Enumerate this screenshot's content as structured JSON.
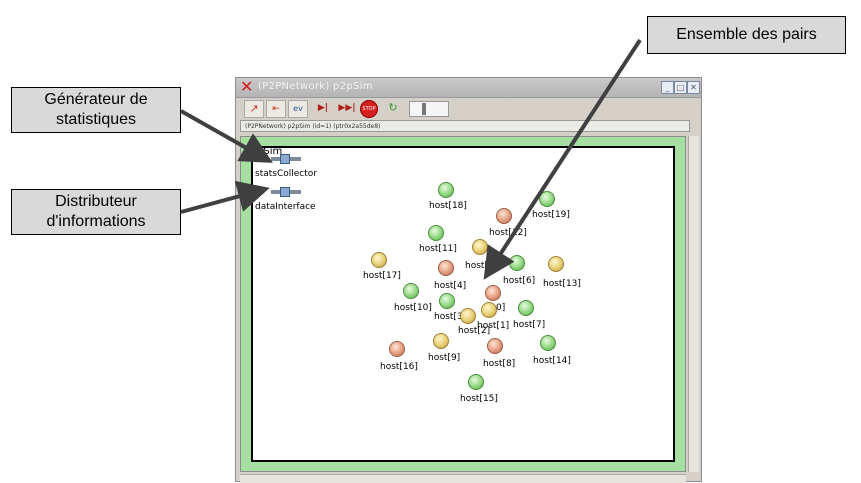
{
  "callouts": {
    "generator": "Générateur de\nstatistiques",
    "distributor": "Distributeur\nd'informations",
    "pairs": "Ensemble des pairs"
  },
  "window": {
    "title": "(P2PNetwork) p2pSim",
    "status": "(P2PNetwork) p2pSim (id=1) (ptr0x2a55de8)",
    "network_name": "P2Sim",
    "controls": [
      "minimize",
      "maximize",
      "close"
    ]
  },
  "toolbar": {
    "buttons": [
      {
        "icon": "step-back-icon",
        "glyph": "↗"
      },
      {
        "icon": "network-icon",
        "glyph": "⇤"
      },
      {
        "icon": "event-icon",
        "glyph": "ev"
      },
      {
        "icon": "run-icon",
        "glyph": "▶|"
      },
      {
        "icon": "fast-run-icon",
        "glyph": "▶▶|"
      },
      {
        "icon": "stop-icon",
        "glyph": "STOP"
      },
      {
        "icon": "refresh-icon",
        "glyph": "↻"
      }
    ]
  },
  "modules": [
    {
      "name": "statsCollector"
    },
    {
      "name": "dataInterface"
    }
  ],
  "hosts": [
    {
      "label": "host[18]",
      "color": "green"
    },
    {
      "label": "host[19]",
      "color": "green"
    },
    {
      "label": "host[12]",
      "color": "orange"
    },
    {
      "label": "host[11]",
      "color": "green"
    },
    {
      "label": "host[5]",
      "color": "yellow"
    },
    {
      "label": "host[17]",
      "color": "yellow"
    },
    {
      "label": "host[4]",
      "color": "orange"
    },
    {
      "label": "host[6]",
      "color": "green"
    },
    {
      "label": "host[13]",
      "color": "yellow"
    },
    {
      "label": "host[10]",
      "color": "green"
    },
    {
      "label": "0]",
      "color": "orange"
    },
    {
      "label": "host[3]",
      "color": "green"
    },
    {
      "label": "host[2]",
      "color": "yellow"
    },
    {
      "label": "host[1]",
      "color": "yellow"
    },
    {
      "label": "host[7]",
      "color": "green"
    },
    {
      "label": "host[16]",
      "color": "orange"
    },
    {
      "label": "host[9]",
      "color": "yellow"
    },
    {
      "label": "host[8]",
      "color": "orange"
    },
    {
      "label": "host[14]",
      "color": "green"
    },
    {
      "label": "host[15]",
      "color": "green"
    }
  ],
  "colors": {
    "canvas_border": "#a5e0a0",
    "arrow": "#404040",
    "callout_bg": "#d9d9d9"
  }
}
